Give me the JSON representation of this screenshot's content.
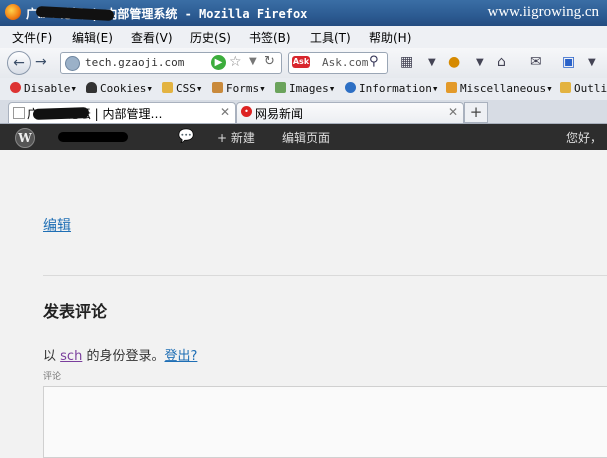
{
  "window": {
    "title": "广… …论坛 | 内部管理系统 - Mozilla Firefox",
    "watermark": "www.iigrowing.cn"
  },
  "menu": {
    "items": [
      "文件(F)",
      "编辑(E)",
      "查看(V)",
      "历史(S)",
      "书签(B)",
      "工具(T)",
      "帮助(H)"
    ]
  },
  "nav": {
    "url": "tech.gzaoji.com",
    "search_placeholder": "Ask.com",
    "search_logo": "Ask"
  },
  "bookmarks": {
    "items": [
      "Disable",
      "Cookies",
      "CSS",
      "Forms",
      "Images",
      "Information",
      "Miscellaneous",
      "Outli"
    ]
  },
  "tabs": {
    "items": [
      {
        "label": "广…  …论坛 | 内部管理…"
      },
      {
        "label": "网易新闻"
      }
    ],
    "new_tab": "+"
  },
  "adminbar": {
    "logo": "W",
    "new_label": "新建",
    "edit_page_label": "编辑页面",
    "greeting": "您好，"
  },
  "page": {
    "edit_link": "编辑",
    "comment_heading": "发表评论",
    "logged_in_prefix": "以",
    "username": "sch",
    "logged_in_suffix": "的身份登录。",
    "logout": "登出?",
    "comment_label": "评论"
  }
}
